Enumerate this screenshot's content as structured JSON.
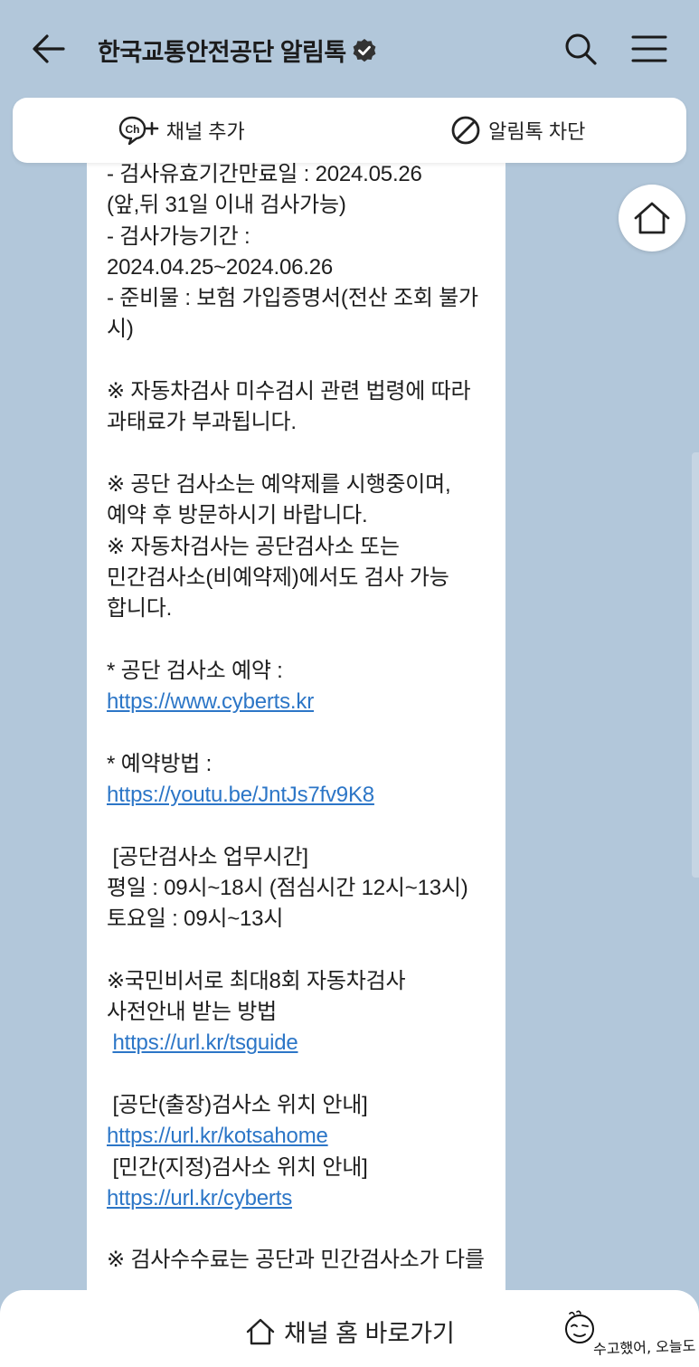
{
  "header": {
    "title": "한국교통안전공단 알림톡",
    "icons": [
      "back-arrow-icon",
      "verified-badge-icon",
      "search-icon",
      "menu-icon"
    ]
  },
  "actions": {
    "add_channel": "채널 추가",
    "block": "알림톡 차단"
  },
  "message": {
    "lines": [
      {
        "text": "- 검사유효기간만료일 : 2024.05.26"
      },
      {
        "text": "(앞,뒤 31일 이내 검사가능)"
      },
      {
        "text": "- 검사가능기간 :"
      },
      {
        "text": "2024.04.25~2024.06.26"
      },
      {
        "text": "- 준비물 : 보험 가입증명서(전산 조회 불가"
      },
      {
        "text": "시)"
      },
      {
        "text": ""
      },
      {
        "text": "※ 자동차검사 미수검시 관련 법령에 따라"
      },
      {
        "text": "과태료가 부과됩니다."
      },
      {
        "text": ""
      },
      {
        "text": "※ 공단 검사소는 예약제를 시행중이며,"
      },
      {
        "text": "예약 후 방문하시기 바랍니다."
      },
      {
        "text": "※ 자동차검사는 공단검사소 또는"
      },
      {
        "text": "민간검사소(비예약제)에서도 검사 가능"
      },
      {
        "text": "합니다."
      },
      {
        "text": ""
      },
      {
        "text": "* 공단 검사소 예약 :"
      },
      {
        "link": "https://www.cyberts.kr"
      },
      {
        "text": ""
      },
      {
        "text": "* 예약방법 :"
      },
      {
        "link": "https://youtu.be/JntJs7fv9K8"
      },
      {
        "text": ""
      },
      {
        "text": " [공단검사소 업무시간]"
      },
      {
        "text": "평일 : 09시~18시 (점심시간 12시~13시)"
      },
      {
        "text": "토요일 : 09시~13시"
      },
      {
        "text": ""
      },
      {
        "text": "※국민비서로 최대8회 자동차검사"
      },
      {
        "text": "사전안내 받는 방법"
      },
      {
        "link": "https://url.kr/tsguide",
        "prefix": " "
      },
      {
        "text": ""
      },
      {
        "text": " [공단(출장)검사소 위치 안내]"
      },
      {
        "link": "https://url.kr/kotsahome"
      },
      {
        "text": " [민간(지정)검사소 위치 안내]"
      },
      {
        "link": "https://url.kr/cyberts"
      },
      {
        "text": ""
      },
      {
        "text": "※ 검사수수료는 공단과 민간검사소가 다를"
      }
    ]
  },
  "bottom": {
    "channel_home": "채널 홈 바로가기",
    "sticker_text": "수고했어, 오늘도"
  },
  "colors": {
    "background": "#b2c7da",
    "link": "#2c76c7",
    "bubble": "#ffffff"
  }
}
